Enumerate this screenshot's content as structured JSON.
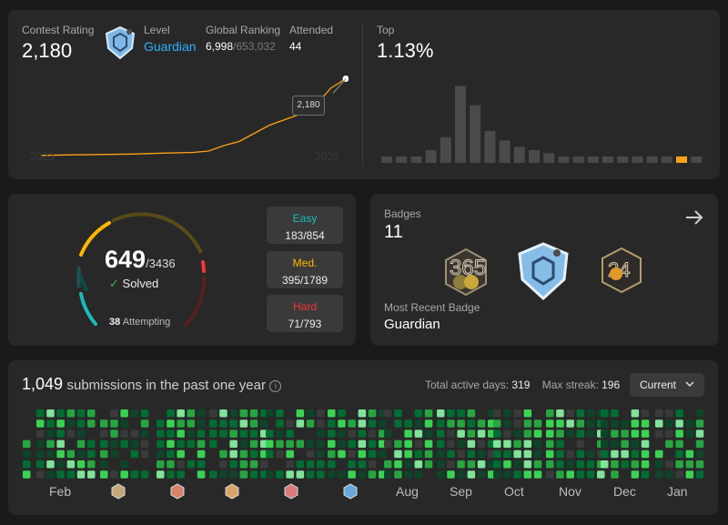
{
  "rating": {
    "contest_label": "Contest Rating",
    "contest_value": "2,180",
    "level_label": "Level",
    "level_value": "Guardian",
    "global_label": "Global Ranking",
    "global_rank": "6,998",
    "global_total": "/653,032",
    "attended_label": "Attended",
    "attended_value": "44",
    "tooltip": "2,180",
    "year_start": "2023",
    "year_end": "2025",
    "top_label": "Top",
    "top_value": "1.13%",
    "accent_color": "#ffa116",
    "guardian_color": "#2db0ff"
  },
  "chart_data": {
    "type": "bar",
    "values": [
      1,
      1,
      1,
      2,
      4,
      12,
      9,
      5,
      3.5,
      2.5,
      2,
      1.5,
      1,
      1,
      1,
      1,
      1,
      1,
      1,
      1,
      1,
      1
    ],
    "highlight_index": 20,
    "ylim": [
      0,
      12.5
    ]
  },
  "rating_line": {
    "points": [
      [
        0,
        1618
      ],
      [
        0.1,
        1622
      ],
      [
        0.2,
        1625
      ],
      [
        0.3,
        1628
      ],
      [
        0.4,
        1635
      ],
      [
        0.5,
        1640
      ],
      [
        0.55,
        1650
      ],
      [
        0.6,
        1690
      ],
      [
        0.65,
        1720
      ],
      [
        0.7,
        1780
      ],
      [
        0.75,
        1840
      ],
      [
        0.8,
        1880
      ],
      [
        0.85,
        1920
      ],
      [
        0.9,
        1980
      ],
      [
        0.95,
        2110
      ],
      [
        1,
        2180
      ]
    ],
    "ylim": [
      1550,
      2250
    ]
  },
  "solved": {
    "count": "649",
    "total": "/3436",
    "solved_label": "Solved",
    "attempting_count": "38",
    "attempting_label": "Attempting",
    "easy_label": "Easy",
    "easy_value": "183/854",
    "easy_color": "#1cbaba",
    "medium_label": "Med.",
    "medium_value": "395/1789",
    "medium_color": "#ffb700",
    "hard_label": "Hard",
    "hard_value": "71/793",
    "hard_color": "#f63737"
  },
  "badges": {
    "label": "Badges",
    "count": "11",
    "recent_label": "Most Recent Badge",
    "recent_value": "Guardian",
    "arrow_icon": "arrow-right-icon"
  },
  "submissions": {
    "count": "1,049",
    "text": "submissions in the past one year",
    "active_label": "Total active days:",
    "active_value": "319",
    "streak_label": "Max streak:",
    "streak_value": "196",
    "dropdown_value": "Current",
    "months": [
      "Feb",
      "Aug",
      "Sep",
      "Oct",
      "Nov",
      "Dec",
      "Jan"
    ]
  }
}
